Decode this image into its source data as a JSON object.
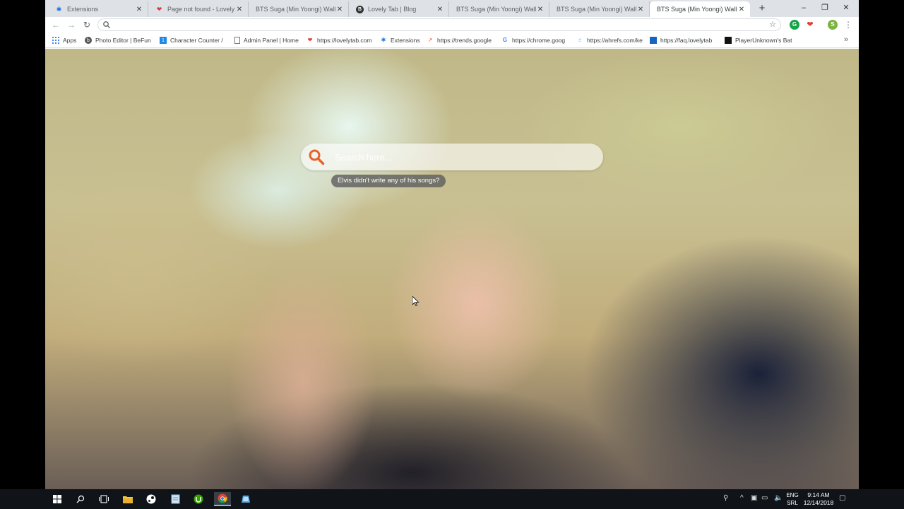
{
  "tabs": [
    {
      "title": "Extensions",
      "favicon": "puzzle-icon",
      "color": "#1a73e8"
    },
    {
      "title": "Page not found - Lovely Ta",
      "favicon": "heart-icon",
      "color": "#e53935"
    },
    {
      "title": "BTS Suga (Min Yoongi) Wallpap",
      "favicon": "blank-page-icon",
      "color": "#9aa0a6"
    },
    {
      "title": "Lovely Tab | Blog",
      "favicon": "b-logo-icon",
      "color": "#333333"
    },
    {
      "title": "BTS Suga (Min Yoongi) Wallpap",
      "favicon": "blank-page-icon",
      "color": "#9aa0a6"
    },
    {
      "title": "BTS Suga (Min Yoongi) Wallpap",
      "favicon": "blank-page-icon",
      "color": "#9aa0a6"
    },
    {
      "title": "BTS Suga (Min Yoongi) Wallpap",
      "favicon": "blank-page-icon",
      "color": "#9aa0a6",
      "active": true
    }
  ],
  "window_controls": {
    "minimize": "–",
    "maximize": "❐",
    "close": "✕"
  },
  "toolbar": {
    "address_value": "",
    "extension_profile_initial": "S"
  },
  "bookmarks": [
    {
      "label": "Apps",
      "icon": "apps-grid-icon"
    },
    {
      "label": "Photo Editor | BeFun",
      "icon": "befunky-icon"
    },
    {
      "label": "Character Counter / ",
      "icon": "counter-icon"
    },
    {
      "label": "Admin Panel | Home",
      "icon": "page-icon"
    },
    {
      "label": "https://lovelytab.com",
      "icon": "heart-icon"
    },
    {
      "label": "Extensions",
      "icon": "puzzle-icon"
    },
    {
      "label": "https://trends.google",
      "icon": "trends-icon"
    },
    {
      "label": "https://chrome.goog",
      "icon": "google-g-icon"
    },
    {
      "label": "https://ahrefs.com/ke",
      "icon": "ahrefs-icon"
    },
    {
      "label": "https://faq.lovelytab",
      "icon": "blue-square-icon"
    },
    {
      "label": "PlayerUnknown's Bat",
      "icon": "pubg-icon"
    }
  ],
  "search": {
    "placeholder": "Search here...",
    "value": ""
  },
  "tooltip": "Elvis didn't write any of his songs?",
  "accent_colors": {
    "search_icon": "#e8632b",
    "taskbar": "#101418",
    "tab_strip": "#dee1e6"
  },
  "taskbar": {
    "apps": [
      "start-icon",
      "search-icon",
      "task-view-icon",
      "file-explorer-icon",
      "steam-icon",
      "notepad-icon",
      "upwork-icon",
      "chrome-icon",
      "app-icon"
    ],
    "lang_top": "ENG",
    "lang_bottom": "SRL",
    "time": "9:14 AM",
    "date": "12/14/2018"
  }
}
